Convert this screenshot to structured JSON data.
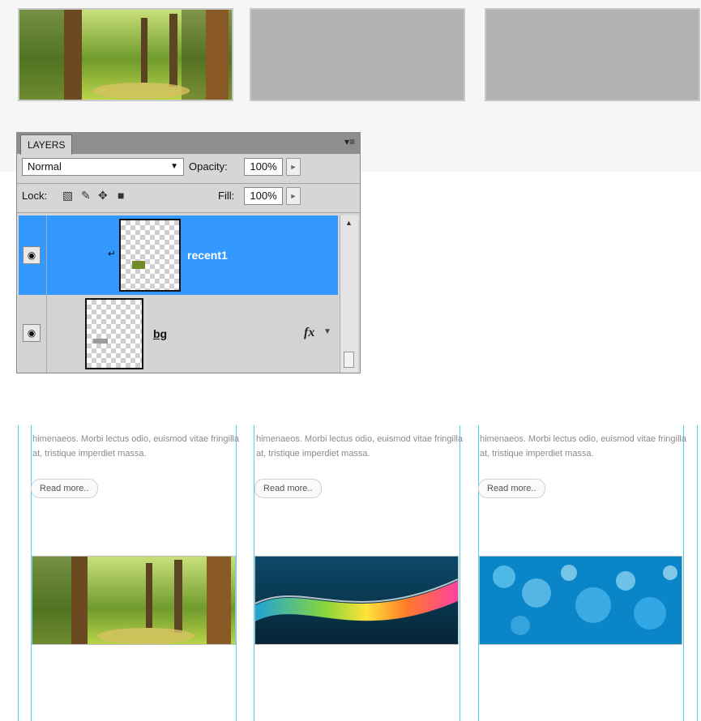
{
  "layers_panel": {
    "tab_label": "LAYERS",
    "blend_mode": "Normal",
    "opacity_label": "Opacity:",
    "opacity_value": "100%",
    "lock_label": "Lock:",
    "fill_label": "Fill:",
    "fill_value": "100%",
    "layers": [
      {
        "name": "recent1",
        "selected": true
      },
      {
        "name": "bg",
        "selected": false,
        "fx": "fx"
      }
    ]
  },
  "columns": [
    {
      "text": "himenaeos. Morbi lectus odio, euismod vitae fringilla at, tristique imperdiet massa.",
      "button": "Read more.."
    },
    {
      "text": "himenaeos. Morbi lectus odio, euismod vitae fringilla at, tristique imperdiet massa.",
      "button": "Read more.."
    },
    {
      "text": "himenaeos. Morbi lectus odio, euismod vitae fringilla at, tristique imperdiet massa.",
      "button": "Read more.."
    }
  ],
  "colors": {
    "selection": "#3399ff",
    "guide": "#4dd4ee",
    "placeholder": "#b1b1b1"
  },
  "icons": [
    "panel-menu-icon",
    "dropdown-caret-icon",
    "arrow-right-icon",
    "lock-transparent-icon",
    "lock-brush-icon",
    "lock-move-icon",
    "lock-all-icon",
    "eye-icon",
    "link-icon",
    "fx-icon",
    "scroll-up-icon",
    "scroll-down-icon"
  ]
}
